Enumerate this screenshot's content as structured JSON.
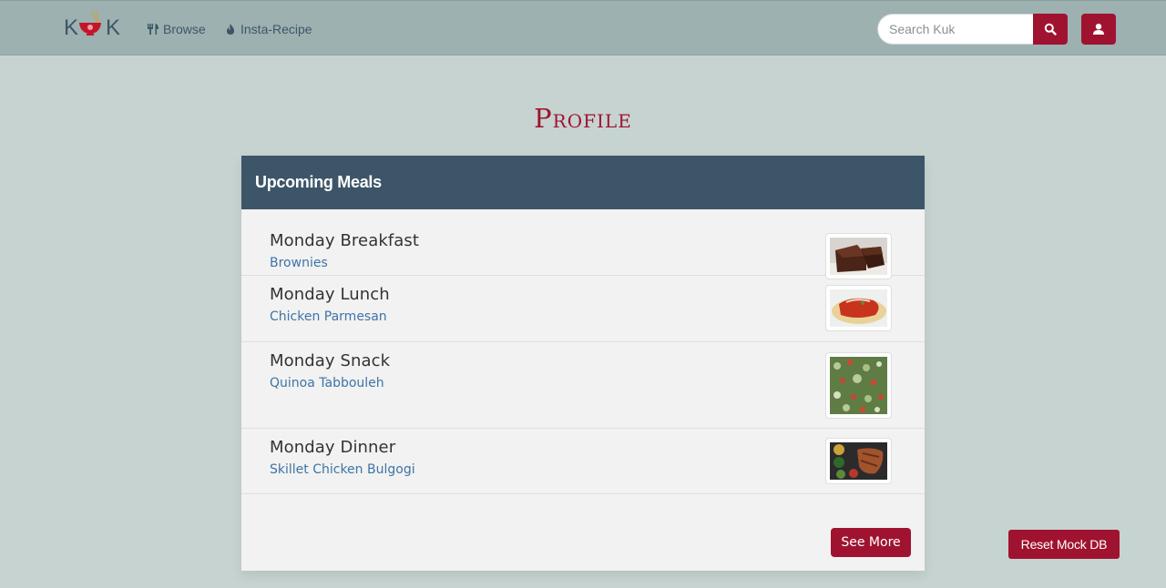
{
  "brand": {
    "logo_text_left": "K",
    "logo_text_right": "K"
  },
  "nav": {
    "browse_label": "Browse",
    "insta_recipe_label": "Insta-Recipe"
  },
  "search": {
    "placeholder": "Search Kuk",
    "value": ""
  },
  "page_title": "Profile",
  "upcoming": {
    "header": "Upcoming Meals",
    "meals": [
      {
        "name": "Monday Breakfast",
        "recipe": "Brownies"
      },
      {
        "name": "Monday Lunch",
        "recipe": "Chicken Parmesan"
      },
      {
        "name": "Monday Snack",
        "recipe": "Quinoa Tabbouleh"
      },
      {
        "name": "Monday Dinner",
        "recipe": "Skillet Chicken Bulgogi"
      }
    ],
    "see_more_label": "See More"
  },
  "reset_label": "Reset Mock DB",
  "colors": {
    "accent": "#a01330",
    "navbar": "#9cb1b0",
    "panel_header": "#3d5568",
    "link": "#3f73a8",
    "background": "#c6d3d1"
  }
}
